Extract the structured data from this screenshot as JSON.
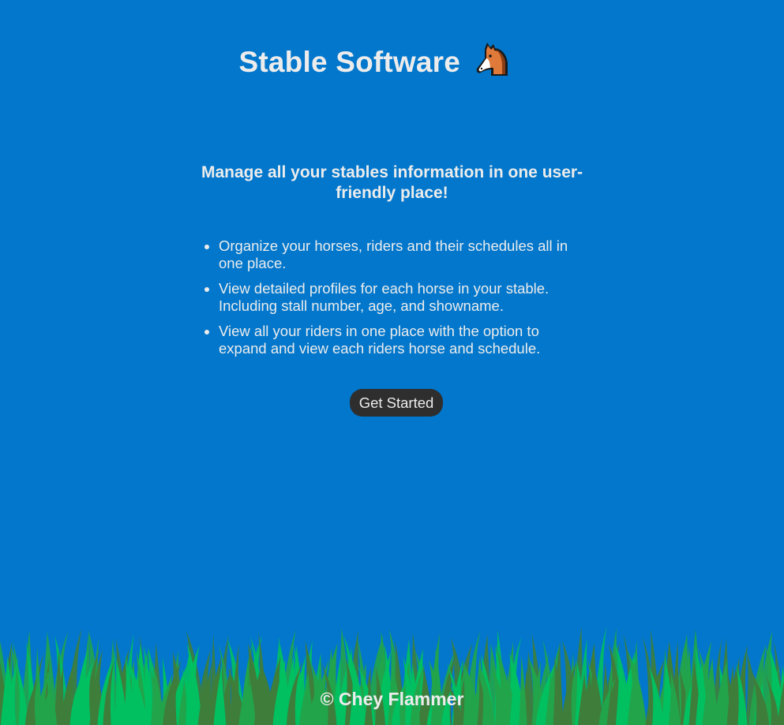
{
  "header": {
    "title": "Stable Software",
    "icon": "horse-face-icon"
  },
  "tagline": "Manage all your stables information in one user-friendly place!",
  "features": [
    "Organize your horses, riders and their schedules all in one place.",
    "View detailed profiles for each horse in your stable. Including stall number, age, and showname.",
    "View all your riders in one place with the option to expand and view each riders horse and schedule."
  ],
  "cta": {
    "label": "Get Started"
  },
  "footer": {
    "text": "© Chey Flammer"
  },
  "colors": {
    "background": "#0277cc",
    "text": "#ececec",
    "button": "#2e2e2e",
    "grass_light": "#00c060",
    "grass_mid": "#22a44a",
    "grass_dark": "#3f7d3a"
  }
}
